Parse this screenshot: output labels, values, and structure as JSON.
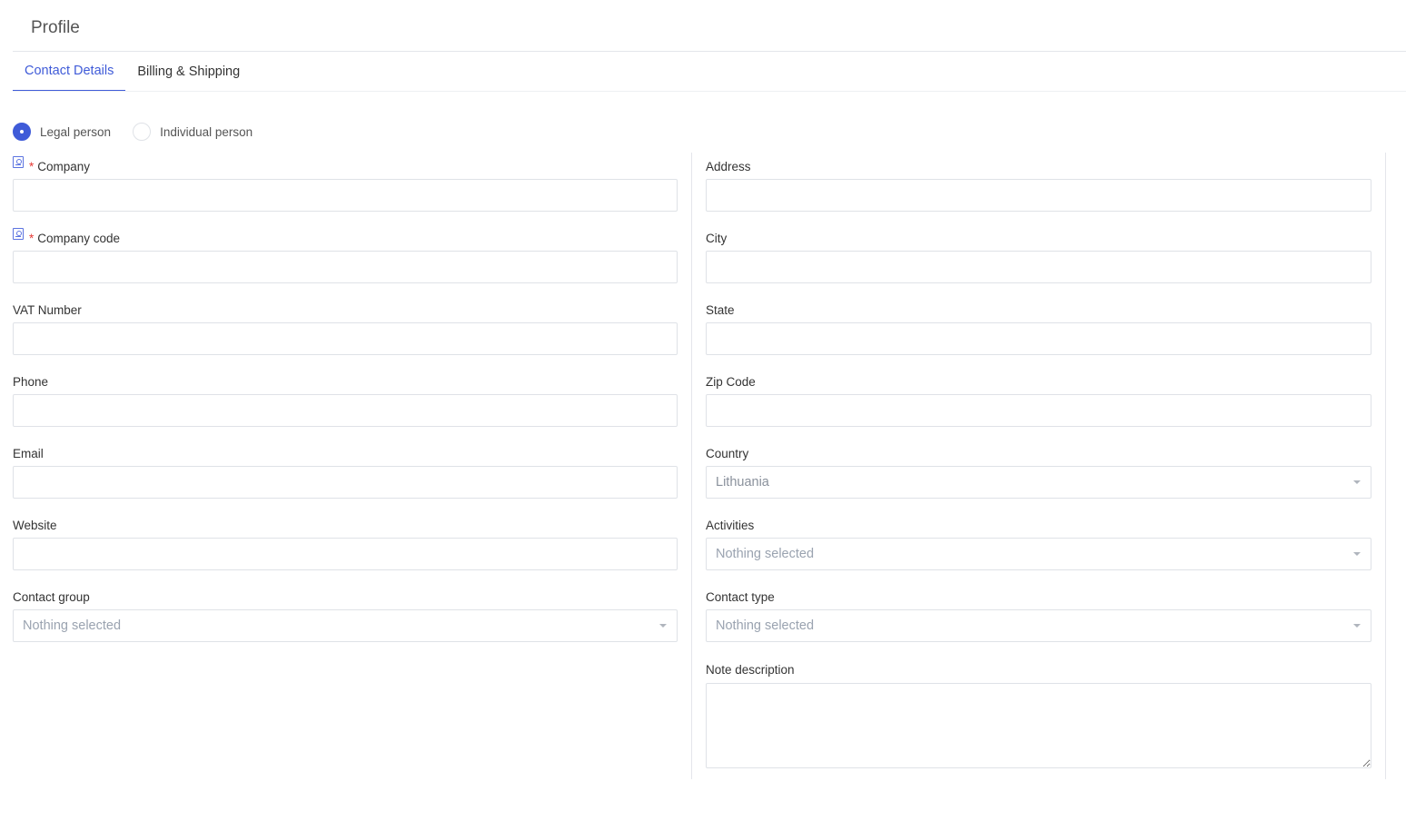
{
  "header": {
    "title": "Profile"
  },
  "tabs": [
    {
      "label": "Contact Details",
      "active": true
    },
    {
      "label": "Billing & Shipping",
      "active": false
    }
  ],
  "person_type": {
    "options": [
      {
        "label": "Legal person",
        "checked": true
      },
      {
        "label": "Individual person",
        "checked": false
      }
    ]
  },
  "left_fields": {
    "company": {
      "label": "Company",
      "required": true,
      "value": ""
    },
    "company_code": {
      "label": "Company code",
      "required": true,
      "value": ""
    },
    "vat_number": {
      "label": "VAT Number",
      "value": ""
    },
    "phone": {
      "label": "Phone",
      "value": ""
    },
    "email": {
      "label": "Email",
      "value": ""
    },
    "website": {
      "label": "Website",
      "value": ""
    },
    "contact_group": {
      "label": "Contact group",
      "value": "Nothing selected"
    }
  },
  "right_fields": {
    "address": {
      "label": "Address",
      "value": ""
    },
    "city": {
      "label": "City",
      "value": ""
    },
    "state": {
      "label": "State",
      "value": ""
    },
    "zip_code": {
      "label": "Zip Code",
      "value": ""
    },
    "country": {
      "label": "Country",
      "value": "Lithuania"
    },
    "activities": {
      "label": "Activities",
      "value": "Nothing selected"
    },
    "contact_type": {
      "label": "Contact type",
      "value": "Nothing selected"
    },
    "note_description": {
      "label": "Note description",
      "value": ""
    }
  },
  "required_marker": "*",
  "colors": {
    "accent": "#3f5bd8",
    "required": "#e53935",
    "border": "#dfe2e7",
    "placeholder": "#9aa3b0"
  }
}
